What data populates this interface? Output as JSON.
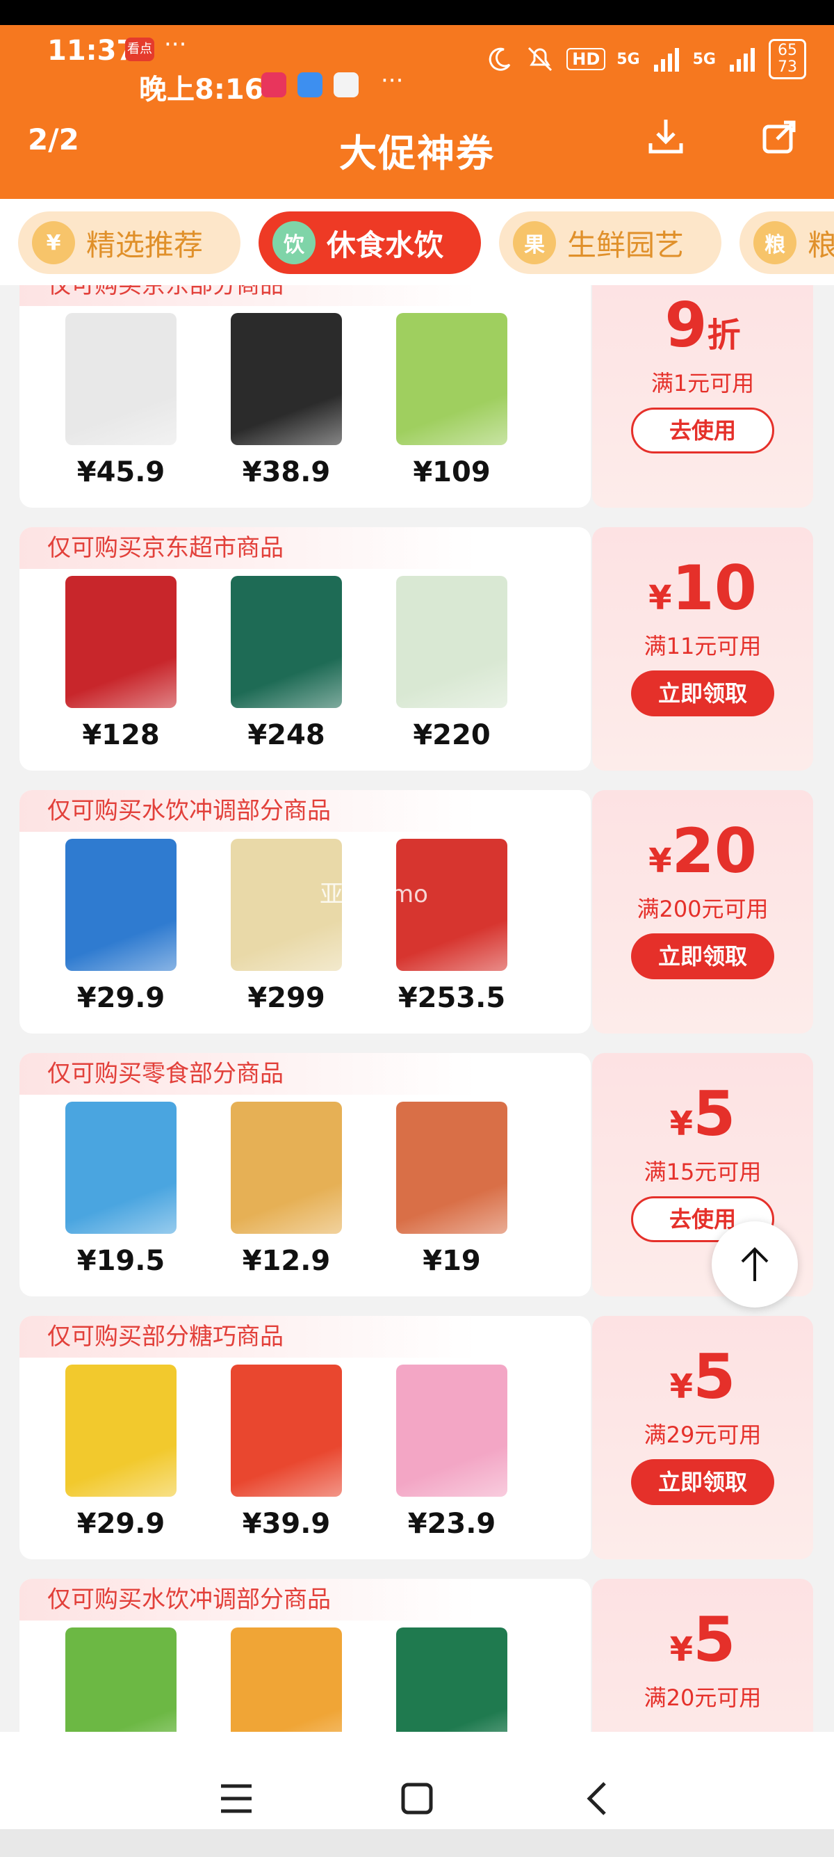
{
  "status": {
    "time": "11:37",
    "app_badge": "看点",
    "more1": "···",
    "time2": "晚上8:16",
    "more2": "···",
    "hd_label": "HD",
    "network1": "5G",
    "network2": "5G",
    "battery_top": "65",
    "battery_bottom": "73"
  },
  "header": {
    "page_indicator": "2/2",
    "title": "大促神券",
    "download_icon": "download-icon",
    "share_icon": "share-icon",
    "bg_color": "#f6781f"
  },
  "tabs": [
    {
      "label": "精选推荐",
      "icon": "¥",
      "active": false
    },
    {
      "label": "休食水饮",
      "icon": "饮",
      "active": true
    },
    {
      "label": "生鲜园艺",
      "icon": "果",
      "active": false
    },
    {
      "label": "粮",
      "icon": "粮",
      "active": false
    }
  ],
  "coupons": [
    {
      "title": "仅可购买京东部分商品",
      "products": [
        {
          "price": "¥45.9",
          "color": "#e8e8e8"
        },
        {
          "price": "¥38.9",
          "color": "#2b2b2b"
        },
        {
          "price": "¥109",
          "color": "#9fcf5f"
        }
      ],
      "amount_value": "9",
      "amount_unit": "折",
      "amount_prefix": "",
      "condition": "满1元可用",
      "button": "去使用",
      "button_type": "use"
    },
    {
      "title": "仅可购买京东超市商品",
      "products": [
        {
          "price": "¥128",
          "color": "#c8262b"
        },
        {
          "price": "¥248",
          "color": "#1e6b55"
        },
        {
          "price": "¥220",
          "color": "#d9e8d3"
        }
      ],
      "amount_value": "10",
      "amount_unit": "",
      "amount_prefix": "¥",
      "condition": "满11元可用",
      "button": "立即领取",
      "button_type": "get"
    },
    {
      "title": "仅可购买水饮冲调部分商品",
      "products": [
        {
          "price": "¥29.9",
          "color": "#2f7bd0"
        },
        {
          "price": "¥299",
          "color": "#e9d9a8"
        },
        {
          "price": "¥253.5",
          "color": "#d7352f"
        }
      ],
      "amount_value": "20",
      "amount_unit": "",
      "amount_prefix": "¥",
      "condition": "满200元可用",
      "button": "立即领取",
      "button_type": "get"
    },
    {
      "title": "仅可购买零食部分商品",
      "products": [
        {
          "price": "¥19.5",
          "color": "#4aa5e0"
        },
        {
          "price": "¥12.9",
          "color": "#e6b055"
        },
        {
          "price": "¥19",
          "color": "#d96f47"
        }
      ],
      "amount_value": "5",
      "amount_unit": "",
      "amount_prefix": "¥",
      "condition": "满15元可用",
      "button": "去使用",
      "button_type": "use"
    },
    {
      "title": "仅可购买部分糖巧商品",
      "products": [
        {
          "price": "¥29.9",
          "color": "#f2c92d"
        },
        {
          "price": "¥39.9",
          "color": "#e9472f"
        },
        {
          "price": "¥23.9",
          "color": "#f3a6c5"
        }
      ],
      "amount_value": "5",
      "amount_unit": "",
      "amount_prefix": "¥",
      "condition": "满29元可用",
      "button": "立即领取",
      "button_type": "get"
    },
    {
      "title": "仅可购买水饮冲调部分商品",
      "products": [
        {
          "price": "",
          "color": "#6cb844"
        },
        {
          "price": "",
          "color": "#f0a536"
        },
        {
          "price": "",
          "color": "#1f7a4f"
        }
      ],
      "amount_value": "5",
      "amount_unit": "",
      "amount_prefix": "¥",
      "condition": "满20元可用",
      "button": "",
      "button_type": "none"
    }
  ],
  "watermark": "亚当新mo",
  "back_to_top_icon": "arrow-up-icon",
  "nav": {
    "menu_icon": "menu-icon",
    "home_icon": "home-icon",
    "back_icon": "back-icon"
  }
}
